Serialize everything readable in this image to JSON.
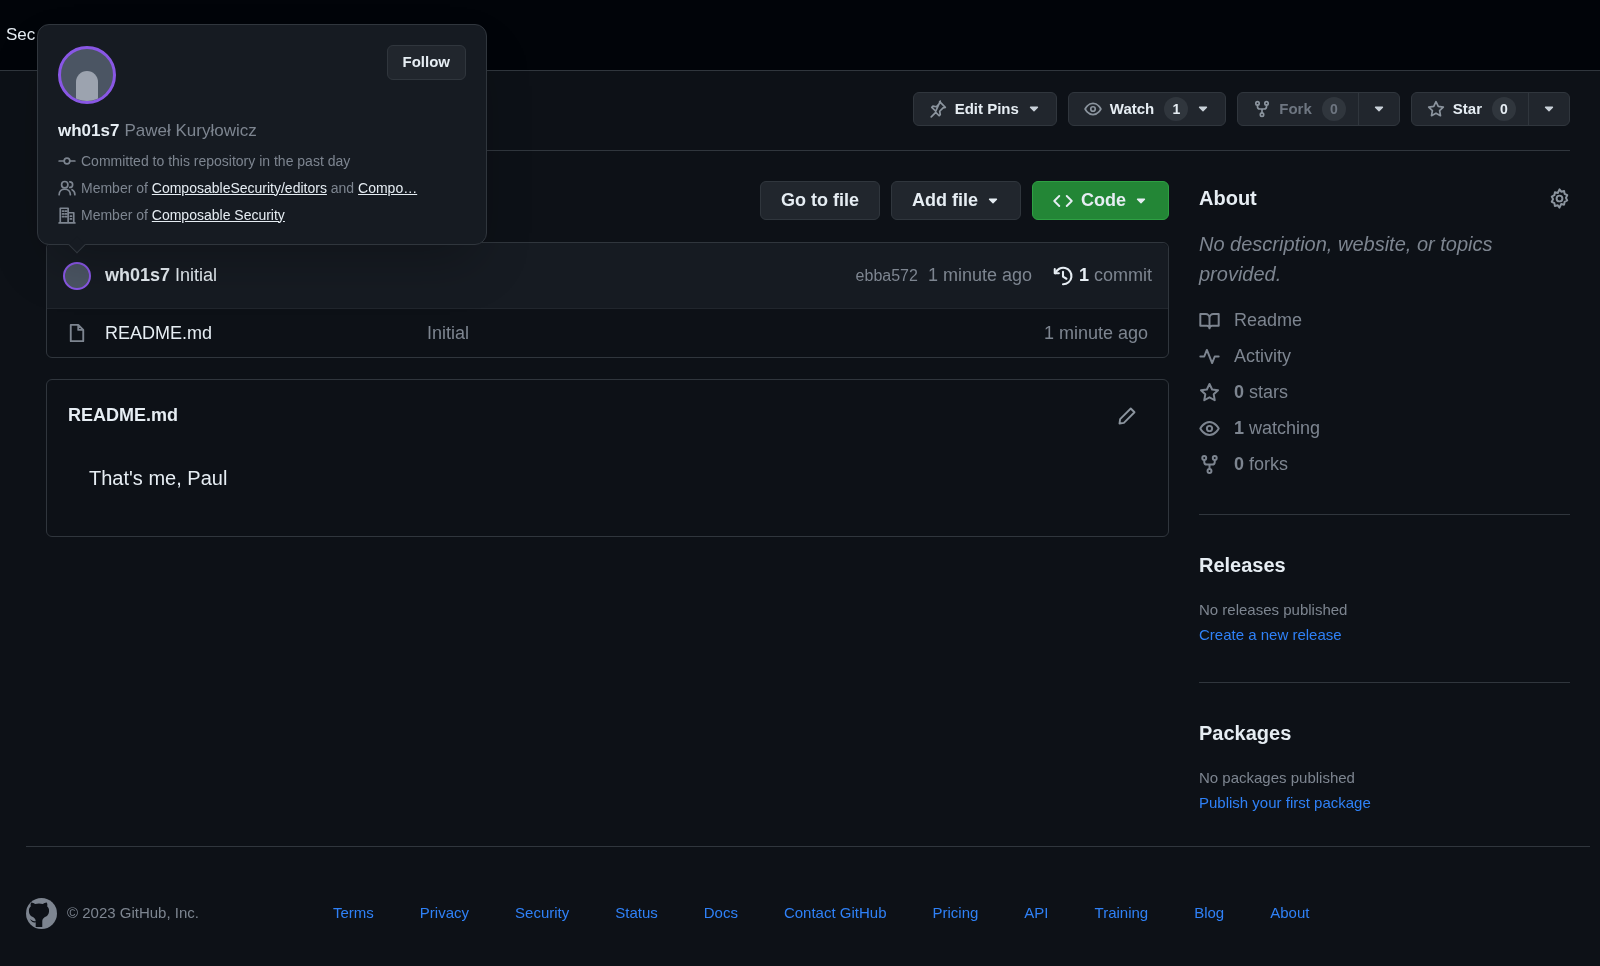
{
  "header": {
    "partial_text": "Sec"
  },
  "hovercard": {
    "follow_button": "Follow",
    "username": "wh01s7",
    "full_name": "Paweł Kuryłowicz",
    "lines": [
      {
        "kind": "commit",
        "segments": [
          {
            "kind": "text",
            "text": "Committed to this repository in the past day"
          }
        ]
      },
      {
        "kind": "people",
        "segments": [
          {
            "kind": "text",
            "text": "Member of"
          },
          {
            "kind": "link",
            "text": "ComposableSecurity/editors"
          },
          {
            "kind": "text",
            "text": "and"
          },
          {
            "kind": "link",
            "text": "Compo…"
          }
        ]
      },
      {
        "kind": "organization",
        "segments": [
          {
            "kind": "text",
            "text": "Member of"
          },
          {
            "kind": "link",
            "text": "Composable Security"
          }
        ]
      }
    ]
  },
  "repo_actions": [
    {
      "kind": "pin",
      "label": "Edit Pins",
      "disabled": false,
      "split": false
    },
    {
      "kind": "watch",
      "label": "Watch",
      "count": "1",
      "disabled": false,
      "split": false
    },
    {
      "kind": "fork",
      "label": "Fork",
      "count": "0",
      "disabled": true,
      "split": true
    },
    {
      "kind": "star",
      "label": "Star",
      "count": "0",
      "disabled": false,
      "split": true
    }
  ],
  "file_toolbar": [
    {
      "kind": "plain",
      "label": "Go to file"
    },
    {
      "kind": "dropdown",
      "label": "Add file"
    },
    {
      "kind": "primary",
      "label": "Code"
    }
  ],
  "latest_commit": {
    "author": "wh01s7",
    "message": "Initial",
    "hash": "ebba572",
    "time": "1 minute ago",
    "count": "1",
    "count_label": "commit"
  },
  "files": [
    {
      "name": "README.md",
      "message": "Initial",
      "time": "1 minute ago"
    }
  ],
  "readme": {
    "title": "README.md",
    "body": "That's me, Paul"
  },
  "sidebar": {
    "about": {
      "title": "About",
      "description": "No description, website, or topics provided.",
      "links": [
        {
          "kind": "book",
          "label": "Readme"
        },
        {
          "kind": "pulse",
          "label": "Activity"
        },
        {
          "kind": "star",
          "label": "**0** stars"
        },
        {
          "kind": "eye",
          "label": "**1** watching"
        },
        {
          "kind": "fork",
          "label": "**0** forks"
        }
      ]
    },
    "releases": {
      "title": "Releases",
      "empty": "No releases published",
      "link": "Create a new release"
    },
    "packages": {
      "title": "Packages",
      "empty": "No packages published",
      "link": "Publish your first package"
    }
  },
  "footer": {
    "copyright": "© 2023 GitHub, Inc.",
    "links": [
      "Terms",
      "Privacy",
      "Security",
      "Status",
      "Docs",
      "Contact GitHub",
      "Pricing",
      "API",
      "Training",
      "Blog",
      "About"
    ]
  }
}
